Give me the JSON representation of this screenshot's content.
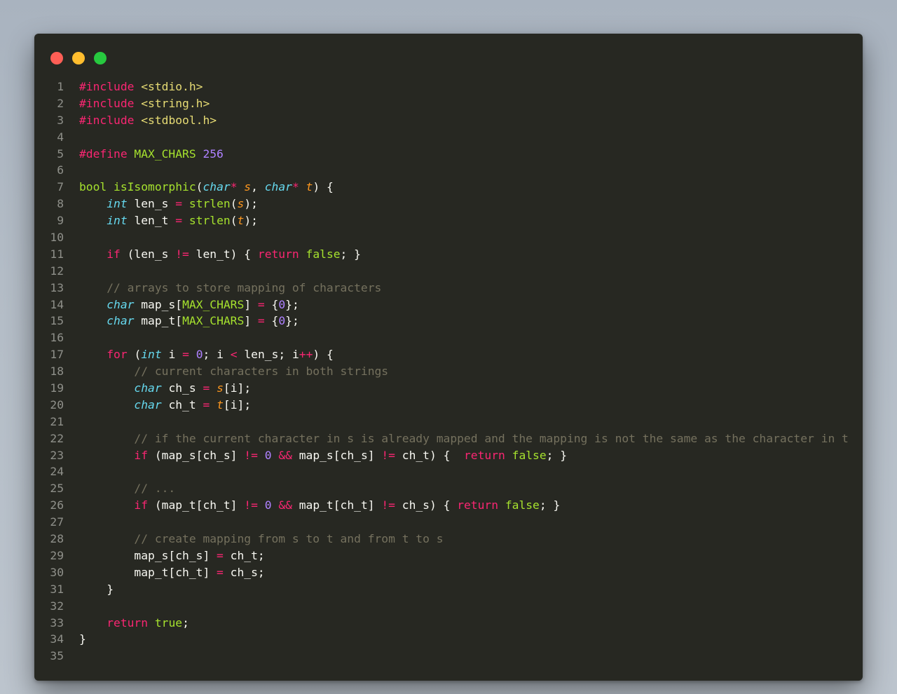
{
  "window": {
    "controls": [
      "close",
      "minimize",
      "zoom"
    ]
  },
  "editor": {
    "language": "c",
    "lines": [
      {
        "n": "1",
        "t": [
          [
            "pp",
            "#include "
          ],
          [
            "hdr",
            "<stdio.h>"
          ]
        ]
      },
      {
        "n": "2",
        "t": [
          [
            "pp",
            "#include "
          ],
          [
            "hdr",
            "<string.h>"
          ]
        ]
      },
      {
        "n": "3",
        "t": [
          [
            "pp",
            "#include "
          ],
          [
            "hdr",
            "<stdbool.h>"
          ]
        ]
      },
      {
        "n": "4",
        "t": []
      },
      {
        "n": "5",
        "t": [
          [
            "pp",
            "#define "
          ],
          [
            "fn",
            "MAX_CHARS "
          ],
          [
            "num",
            "256"
          ]
        ]
      },
      {
        "n": "6",
        "t": []
      },
      {
        "n": "7",
        "t": [
          [
            "bt",
            "bool "
          ],
          [
            "fn",
            "isIsomorphic"
          ],
          [
            "pl",
            "("
          ],
          [
            "ty",
            "char"
          ],
          [
            "op",
            "* "
          ],
          [
            "param",
            "s"
          ],
          [
            "pl",
            ", "
          ],
          [
            "ty",
            "char"
          ],
          [
            "op",
            "* "
          ],
          [
            "param",
            "t"
          ],
          [
            "pl",
            ") {"
          ]
        ]
      },
      {
        "n": "8",
        "t": [
          [
            "pl",
            "    "
          ],
          [
            "ty",
            "int"
          ],
          [
            "pl",
            " len_s "
          ],
          [
            "op",
            "="
          ],
          [
            "pl",
            " "
          ],
          [
            "fn",
            "strlen"
          ],
          [
            "pl",
            "("
          ],
          [
            "param",
            "s"
          ],
          [
            "pl",
            ");"
          ]
        ]
      },
      {
        "n": "9",
        "t": [
          [
            "pl",
            "    "
          ],
          [
            "ty",
            "int"
          ],
          [
            "pl",
            " len_t "
          ],
          [
            "op",
            "="
          ],
          [
            "pl",
            " "
          ],
          [
            "fn",
            "strlen"
          ],
          [
            "pl",
            "("
          ],
          [
            "param",
            "t"
          ],
          [
            "pl",
            ");"
          ]
        ]
      },
      {
        "n": "10",
        "t": []
      },
      {
        "n": "11",
        "t": [
          [
            "pl",
            "    "
          ],
          [
            "kw",
            "if"
          ],
          [
            "pl",
            " (len_s "
          ],
          [
            "op",
            "!="
          ],
          [
            "pl",
            " len_t) { "
          ],
          [
            "kw",
            "return"
          ],
          [
            "pl",
            " "
          ],
          [
            "bool",
            "false"
          ],
          [
            "pl",
            "; }"
          ]
        ]
      },
      {
        "n": "12",
        "t": []
      },
      {
        "n": "13",
        "t": [
          [
            "pl",
            "    "
          ],
          [
            "cm",
            "// arrays to store mapping of characters"
          ]
        ]
      },
      {
        "n": "14",
        "t": [
          [
            "pl",
            "    "
          ],
          [
            "ty",
            "char"
          ],
          [
            "pl",
            " map_s["
          ],
          [
            "fn",
            "MAX_CHARS"
          ],
          [
            "pl",
            "] "
          ],
          [
            "op",
            "="
          ],
          [
            "pl",
            " {"
          ],
          [
            "num",
            "0"
          ],
          [
            "pl",
            "};"
          ]
        ]
      },
      {
        "n": "15",
        "t": [
          [
            "pl",
            "    "
          ],
          [
            "ty",
            "char"
          ],
          [
            "pl",
            " map_t["
          ],
          [
            "fn",
            "MAX_CHARS"
          ],
          [
            "pl",
            "] "
          ],
          [
            "op",
            "="
          ],
          [
            "pl",
            " {"
          ],
          [
            "num",
            "0"
          ],
          [
            "pl",
            "};"
          ]
        ]
      },
      {
        "n": "16",
        "t": []
      },
      {
        "n": "17",
        "t": [
          [
            "pl",
            "    "
          ],
          [
            "kw",
            "for"
          ],
          [
            "pl",
            " ("
          ],
          [
            "ty",
            "int"
          ],
          [
            "pl",
            " i "
          ],
          [
            "op",
            "="
          ],
          [
            "pl",
            " "
          ],
          [
            "num",
            "0"
          ],
          [
            "pl",
            "; i "
          ],
          [
            "op",
            "<"
          ],
          [
            "pl",
            " len_s; i"
          ],
          [
            "op",
            "++"
          ],
          [
            "pl",
            ") {"
          ]
        ]
      },
      {
        "n": "18",
        "t": [
          [
            "pl",
            "        "
          ],
          [
            "cm",
            "// current characters in both strings"
          ]
        ]
      },
      {
        "n": "19",
        "t": [
          [
            "pl",
            "        "
          ],
          [
            "ty",
            "char"
          ],
          [
            "pl",
            " ch_s "
          ],
          [
            "op",
            "="
          ],
          [
            "pl",
            " "
          ],
          [
            "param",
            "s"
          ],
          [
            "pl",
            "[i];"
          ]
        ]
      },
      {
        "n": "20",
        "t": [
          [
            "pl",
            "        "
          ],
          [
            "ty",
            "char"
          ],
          [
            "pl",
            " ch_t "
          ],
          [
            "op",
            "="
          ],
          [
            "pl",
            " "
          ],
          [
            "param",
            "t"
          ],
          [
            "pl",
            "[i];"
          ]
        ]
      },
      {
        "n": "21",
        "t": []
      },
      {
        "n": "22",
        "t": [
          [
            "pl",
            "        "
          ],
          [
            "cm",
            "// if the current character in s is already mapped and the mapping is not the same as the character in t"
          ]
        ]
      },
      {
        "n": "23",
        "t": [
          [
            "pl",
            "        "
          ],
          [
            "kw",
            "if"
          ],
          [
            "pl",
            " (map_s[ch_s] "
          ],
          [
            "op",
            "!="
          ],
          [
            "pl",
            " "
          ],
          [
            "num",
            "0"
          ],
          [
            "pl",
            " "
          ],
          [
            "op",
            "&&"
          ],
          [
            "pl",
            " map_s[ch_s] "
          ],
          [
            "op",
            "!="
          ],
          [
            "pl",
            " ch_t) {  "
          ],
          [
            "kw",
            "return"
          ],
          [
            "pl",
            " "
          ],
          [
            "bool",
            "false"
          ],
          [
            "pl",
            "; }"
          ]
        ]
      },
      {
        "n": "24",
        "t": []
      },
      {
        "n": "25",
        "t": [
          [
            "pl",
            "        "
          ],
          [
            "cm",
            "// ..."
          ]
        ]
      },
      {
        "n": "26",
        "t": [
          [
            "pl",
            "        "
          ],
          [
            "kw",
            "if"
          ],
          [
            "pl",
            " (map_t[ch_t] "
          ],
          [
            "op",
            "!="
          ],
          [
            "pl",
            " "
          ],
          [
            "num",
            "0"
          ],
          [
            "pl",
            " "
          ],
          [
            "op",
            "&&"
          ],
          [
            "pl",
            " map_t[ch_t] "
          ],
          [
            "op",
            "!="
          ],
          [
            "pl",
            " ch_s) { "
          ],
          [
            "kw",
            "return"
          ],
          [
            "pl",
            " "
          ],
          [
            "bool",
            "false"
          ],
          [
            "pl",
            "; }"
          ]
        ]
      },
      {
        "n": "27",
        "t": []
      },
      {
        "n": "28",
        "t": [
          [
            "pl",
            "        "
          ],
          [
            "cm",
            "// create mapping from s to t and from t to s"
          ]
        ]
      },
      {
        "n": "29",
        "t": [
          [
            "pl",
            "        map_s[ch_s] "
          ],
          [
            "op",
            "="
          ],
          [
            "pl",
            " ch_t;"
          ]
        ]
      },
      {
        "n": "30",
        "t": [
          [
            "pl",
            "        map_t[ch_t] "
          ],
          [
            "op",
            "="
          ],
          [
            "pl",
            " ch_s;"
          ]
        ]
      },
      {
        "n": "31",
        "t": [
          [
            "pl",
            "    }"
          ]
        ]
      },
      {
        "n": "32",
        "t": []
      },
      {
        "n": "33",
        "t": [
          [
            "pl",
            "    "
          ],
          [
            "kw",
            "return"
          ],
          [
            "pl",
            " "
          ],
          [
            "bool",
            "true"
          ],
          [
            "pl",
            ";"
          ]
        ]
      },
      {
        "n": "34",
        "t": [
          [
            "pl",
            "}"
          ]
        ]
      },
      {
        "n": "35",
        "t": []
      }
    ]
  }
}
